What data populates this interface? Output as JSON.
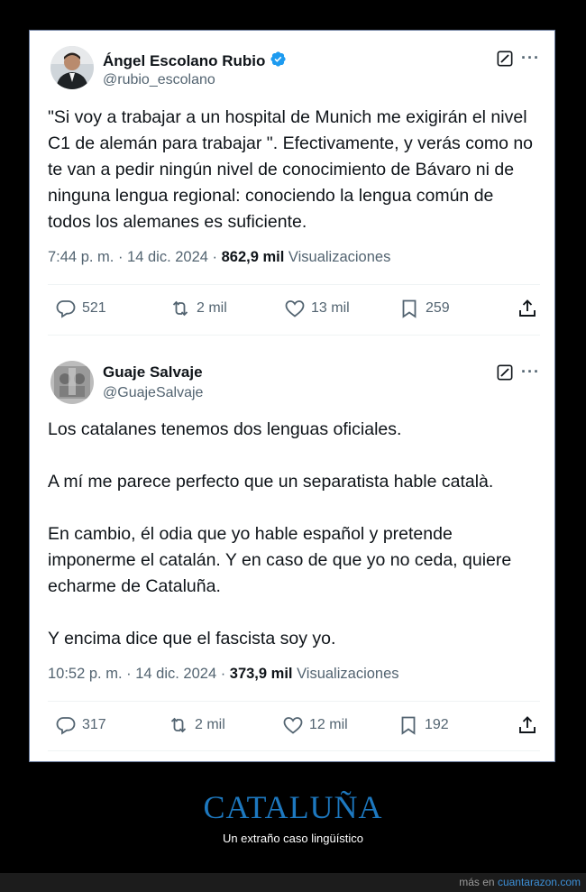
{
  "tweets": [
    {
      "name": "Ángel Escolano Rubio",
      "verified": true,
      "handle": "@rubio_escolano",
      "text": "\"Si voy a trabajar a un hospital de Munich me exigirán el nivel C1 de alemán para trabajar \". Efectivamente, y verás como no te van a pedir ningún nivel de conocimiento de Bávaro ni de ninguna lengua regional: conociendo la lengua común de todos los alemanes es suficiente.",
      "time": "7:44 p. m. · 14 dic. 2024 · ",
      "views": "862,9 mil",
      "views_label": " Visualizaciones",
      "replies": "521",
      "retweets": "2 mil",
      "likes": "13 mil",
      "bookmarks": "259"
    },
    {
      "name": "Guaje Salvaje",
      "verified": false,
      "handle": "@GuajeSalvaje",
      "text": "Los catalanes tenemos dos lenguas oficiales.\n\nA mí me parece perfecto que un separatista hable català.\n\nEn cambio, él odia que yo hable español y pretende imponerme el catalán. Y en caso de que yo no ceda, quiere echarme de Cataluña.\n\nY encima dice que el fascista soy yo.",
      "time": "10:52 p. m. · 14 dic. 2024 · ",
      "views": "373,9 mil",
      "views_label": " Visualizaciones",
      "replies": "317",
      "retweets": "2 mil",
      "likes": "12 mil",
      "bookmarks": "192"
    }
  ],
  "footer": {
    "title": "CATALUÑA",
    "subtitle": "Un extraño caso lingüístico",
    "credit_prefix": "más en ",
    "credit_site": "cuantarazon.com"
  },
  "colors": {
    "accent": "#1d9bf0",
    "footer_title": "#1d78bf"
  }
}
